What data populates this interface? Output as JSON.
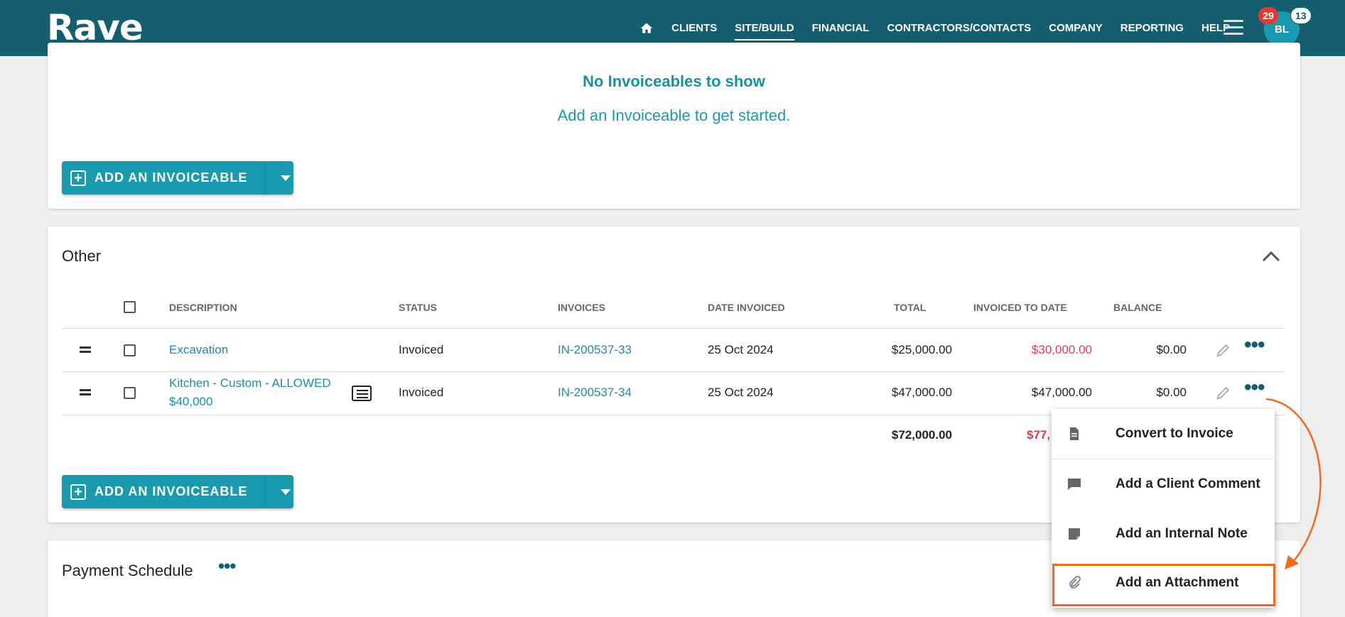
{
  "header": {
    "logo": "Rave",
    "nav": [
      {
        "label": "CLIENTS",
        "active": false
      },
      {
        "label": "SITE/BUILD",
        "active": true
      },
      {
        "label": "FINANCIAL",
        "active": false
      },
      {
        "label": "CONTRACTORS/CONTACTS",
        "active": false
      },
      {
        "label": "COMPANY",
        "active": false
      },
      {
        "label": "REPORTING",
        "active": false
      },
      {
        "label": "HELP",
        "active": false
      }
    ],
    "avatar_initials": "BL",
    "badge_red": "29",
    "badge_white": "13"
  },
  "invoiceables_card": {
    "empty_title": "No Invoiceables to show",
    "empty_subtitle": "Add an Invoiceable to get started.",
    "add_button": "ADD AN INVOICEABLE"
  },
  "other_card": {
    "title": "Other",
    "columns": {
      "description": "DESCRIPTION",
      "status": "STATUS",
      "invoices": "INVOICES",
      "date_invoiced": "DATE INVOICED",
      "total": "TOTAL",
      "invoiced_to_date": "INVOICED TO DATE",
      "balance": "BALANCE"
    },
    "rows": [
      {
        "description": "Excavation",
        "status": "Invoiced",
        "invoice": "IN-200537-33",
        "date": "25 Oct 2024",
        "total": "$25,000.00",
        "invoiced_to_date": "$30,000.00",
        "balance": "$0.00"
      },
      {
        "description_line1": "Kitchen - Custom - ALLOWED",
        "description_line2": "$40,000",
        "status": "Invoiced",
        "invoice": "IN-200537-34",
        "date": "25 Oct 2024",
        "total": "$47,000.00",
        "invoiced_to_date": "$47,000.00",
        "balance": "$0.00"
      }
    ],
    "totals": {
      "total": "$72,000.00",
      "invoiced_to_date_partial": "$77,"
    },
    "add_button": "ADD AN INVOICEABLE"
  },
  "payment_card": {
    "title": "Payment Schedule"
  },
  "context_menu": {
    "items": [
      {
        "label": "Convert to Invoice",
        "icon": "document-icon"
      },
      {
        "label": "Add a Client Comment",
        "icon": "comment-icon"
      },
      {
        "label": "Add an Internal Note",
        "icon": "note-icon"
      },
      {
        "label": "Add an Attachment",
        "icon": "paperclip-icon"
      }
    ]
  },
  "colors": {
    "header": "#155e6f",
    "accent": "#1a9aae",
    "negative": "#e53950",
    "annotation": "#f26a21"
  }
}
